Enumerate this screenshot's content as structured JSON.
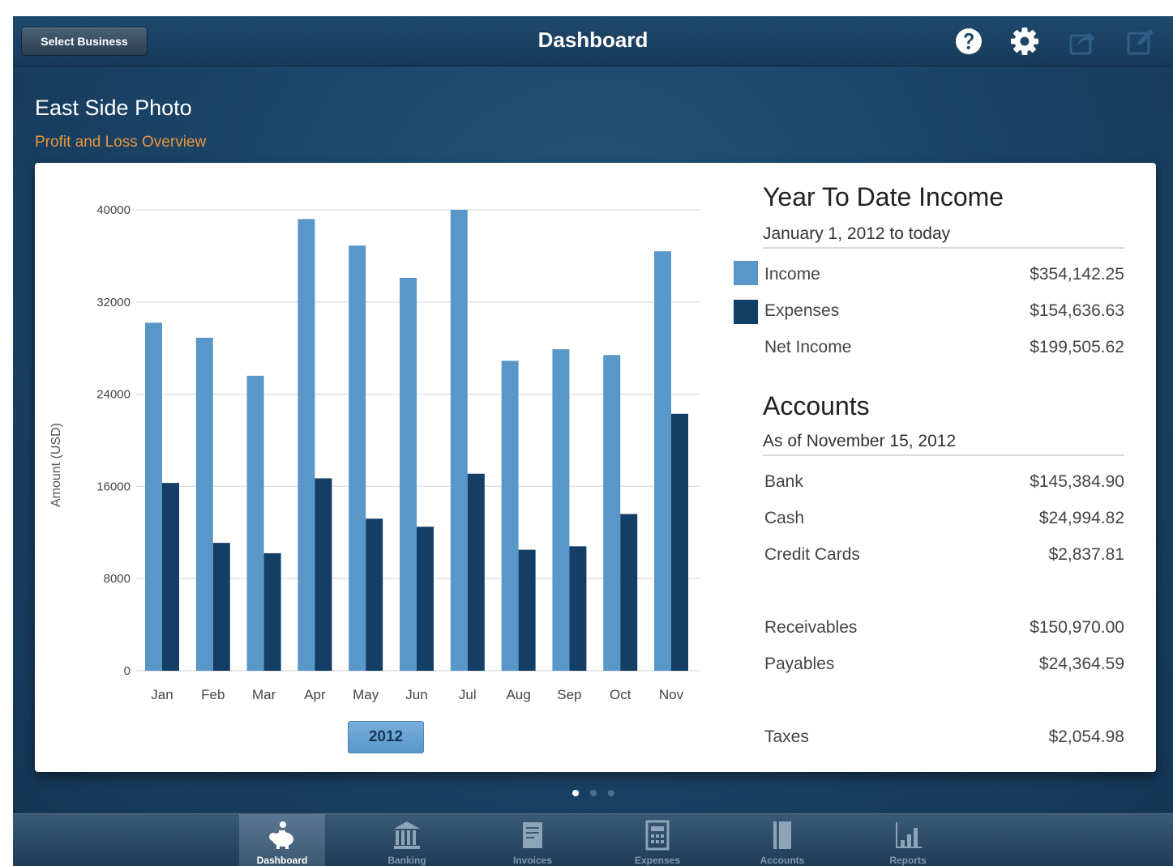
{
  "header": {
    "select_business_label": "Select Business",
    "title": "Dashboard",
    "icons": [
      "help-icon",
      "gear-icon",
      "share-icon",
      "edit-icon"
    ]
  },
  "business": {
    "name": "East Side Photo",
    "subtitle": "Profit and Loss Overview"
  },
  "chart_data": {
    "type": "bar",
    "title": "",
    "xlabel": "",
    "ylabel": "Amount (USD)",
    "categories": [
      "Jan",
      "Feb",
      "Mar",
      "Apr",
      "May",
      "Jun",
      "Jul",
      "Aug",
      "Sep",
      "Oct",
      "Nov"
    ],
    "series": [
      {
        "name": "Income",
        "color": "#5a97c9",
        "values": [
          30200,
          28900,
          25600,
          39200,
          36900,
          34100,
          40000,
          26900,
          27900,
          27400,
          36400
        ]
      },
      {
        "name": "Expenses",
        "color": "#133e66",
        "values": [
          16300,
          11100,
          10200,
          16700,
          13200,
          12500,
          17100,
          10500,
          10800,
          13600,
          22300
        ]
      }
    ],
    "ylim": [
      0,
      40000
    ],
    "yticks": [
      0,
      8000,
      16000,
      24000,
      32000,
      40000
    ],
    "grid": true,
    "year_button": "2012"
  },
  "ytd": {
    "title": "Year To Date Income",
    "subtitle": "January 1, 2012 to today",
    "rows": [
      {
        "label": "Income",
        "value": "$354,142.25",
        "swatch": "#5a97c9"
      },
      {
        "label": "Expenses",
        "value": "$154,636.63",
        "swatch": "#133e66"
      },
      {
        "label": "Net Income",
        "value": "$199,505.62"
      }
    ]
  },
  "accounts": {
    "title": "Accounts",
    "subtitle": "As of November 15, 2012",
    "rows": [
      {
        "label": "Bank",
        "value": "$145,384.90"
      },
      {
        "label": "Cash",
        "value": "$24,994.82"
      },
      {
        "label": "Credit Cards",
        "value": "$2,837.81"
      },
      {
        "label": "Receivables",
        "value": "$150,970.00"
      },
      {
        "label": "Payables",
        "value": "$24,364.59"
      },
      {
        "label": "Taxes",
        "value": "$2,054.98"
      }
    ]
  },
  "pager": {
    "page_count": 3,
    "active_index": 0
  },
  "tabs": [
    {
      "label": "Dashboard",
      "icon": "piggy-bank-icon",
      "selected": true
    },
    {
      "label": "Banking",
      "icon": "bank-icon"
    },
    {
      "label": "Invoices",
      "icon": "invoice-icon"
    },
    {
      "label": "Expenses",
      "icon": "expenses-icon"
    },
    {
      "label": "Accounts",
      "icon": "accounts-icon"
    },
    {
      "label": "Reports",
      "icon": "reports-icon"
    }
  ]
}
